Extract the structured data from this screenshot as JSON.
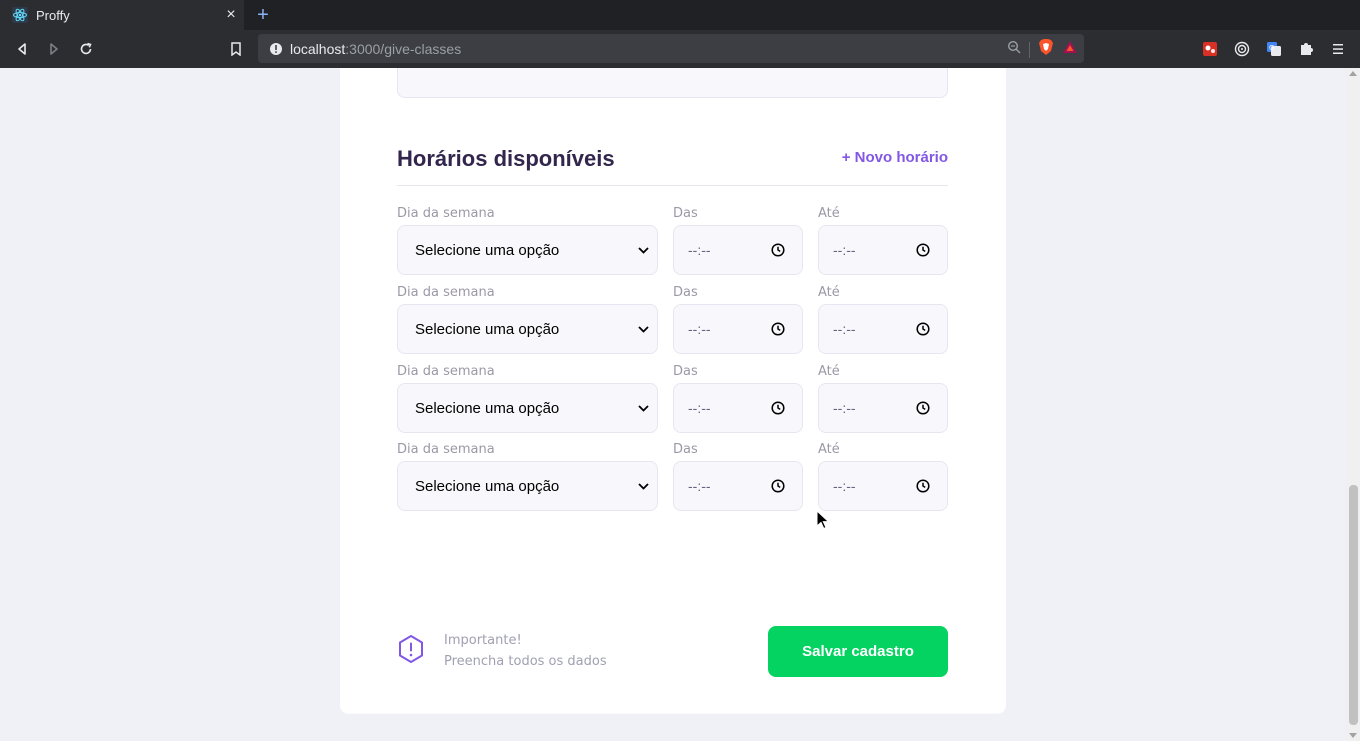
{
  "browser": {
    "tab_title": "Proffy",
    "new_tab_symbol": "+",
    "close_symbol": "×",
    "url_host": "localhost",
    "url_path": ":3000/give-classes"
  },
  "section": {
    "title": "Horários disponíveis",
    "new_time_label": "+ Novo horário"
  },
  "schedule_items": [
    {
      "week_day_label": "Dia da semana",
      "week_day_value": "Selecione uma opção",
      "from_label": "Das",
      "from_value": "--:--",
      "to_label": "Até",
      "to_value": "--:--"
    },
    {
      "week_day_label": "Dia da semana",
      "week_day_value": "Selecione uma opção",
      "from_label": "Das",
      "from_value": "--:--",
      "to_label": "Até",
      "to_value": "--:--"
    },
    {
      "week_day_label": "Dia da semana",
      "week_day_value": "Selecione uma opção",
      "from_label": "Das",
      "from_value": "--:--",
      "to_label": "Até",
      "to_value": "--:--"
    },
    {
      "week_day_label": "Dia da semana",
      "week_day_value": "Selecione uma opção",
      "from_label": "Das",
      "from_value": "--:--",
      "to_label": "Até",
      "to_value": "--:--"
    }
  ],
  "footer": {
    "warning_title": "Importante!",
    "warning_text": "Preencha todos os dados",
    "save_label": "Salvar cadastro"
  },
  "colors": {
    "primary": "#8257e5",
    "title": "#32264d",
    "save": "#04d361",
    "background": "#f0f0f7"
  },
  "icons": [
    "react-icon",
    "back-icon",
    "forward-icon",
    "reload-icon",
    "bookmark-icon",
    "info-icon",
    "zoom-icon",
    "brave-shield-icon",
    "brave-rewards-icon",
    "extension-icon",
    "target-icon",
    "translate-icon",
    "puzzle-icon",
    "menu-icon",
    "chevron-down-icon",
    "clock-icon",
    "warning-icon"
  ]
}
